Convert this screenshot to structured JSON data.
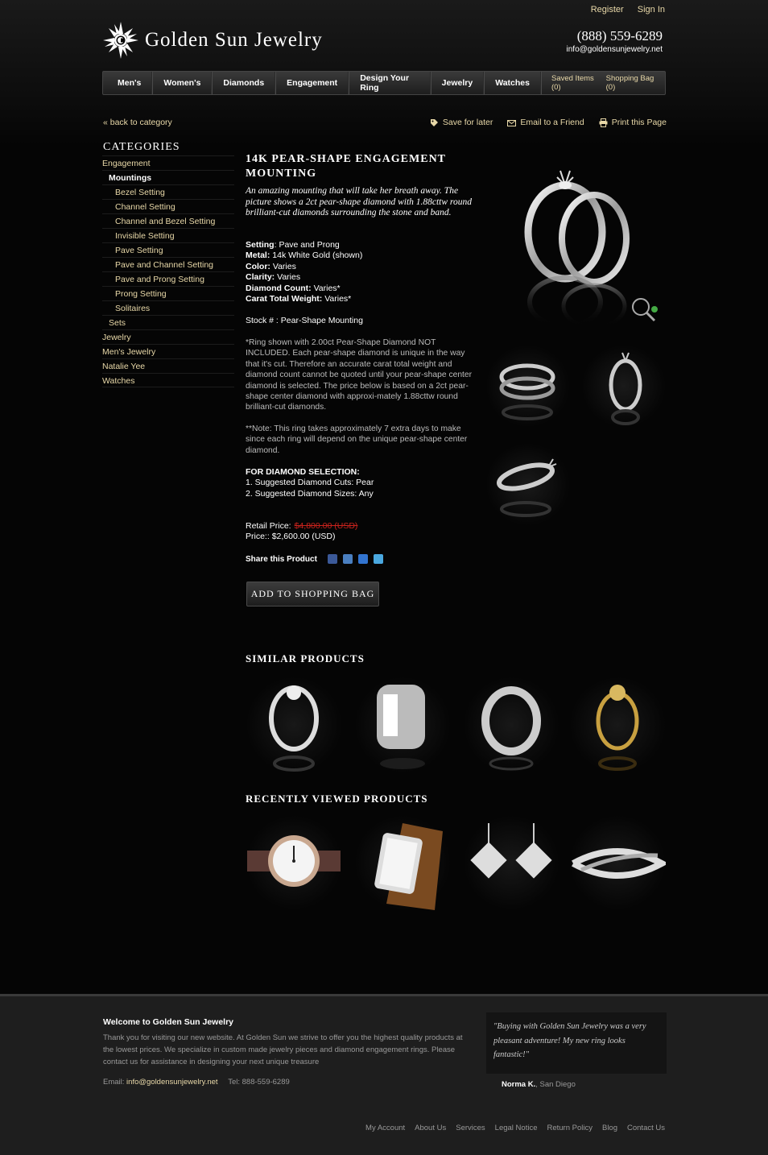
{
  "header": {
    "top_links": [
      "Register",
      "Sign In"
    ],
    "logo_text": "Golden Sun Jewelry",
    "phone": "(888) 559-6289",
    "email": "info@goldensunjewelry.net"
  },
  "nav": {
    "items": [
      "Men's",
      "Women's",
      "Diamonds",
      "Engagement",
      "Design Your Ring",
      "Jewelry",
      "Watches"
    ],
    "saved_items": "Saved Items (0)",
    "shopping_bag": "Shopping Bag (0)"
  },
  "actions": {
    "back": "« back to category",
    "save": "Save for later",
    "email": "Email to a Friend",
    "print": "Print this Page"
  },
  "sidebar": {
    "title": "CATEGORIES",
    "items": [
      {
        "label": "Engagement",
        "level": 0
      },
      {
        "label": "Mountings",
        "level": 1
      },
      {
        "label": "Bezel Setting",
        "level": 2
      },
      {
        "label": "Channel Setting",
        "level": 2
      },
      {
        "label": "Channel and Bezel Setting",
        "level": 2
      },
      {
        "label": "Invisible Setting",
        "level": 2
      },
      {
        "label": "Pave Setting",
        "level": 2
      },
      {
        "label": "Pave and Channel Setting",
        "level": 2
      },
      {
        "label": "Pave and Prong Setting",
        "level": 2
      },
      {
        "label": "Prong Setting",
        "level": 2
      },
      {
        "label": "Solitaires",
        "level": 2
      },
      {
        "label": "Sets",
        "level": 1
      },
      {
        "label": "Jewelry",
        "level": 0
      },
      {
        "label": "Men's Jewelry",
        "level": 0
      },
      {
        "label": "Natalie Yee",
        "level": 0
      },
      {
        "label": "Watches",
        "level": 0
      }
    ]
  },
  "product": {
    "title": "14K PEAR-SHAPE ENGAGEMENT MOUNTING",
    "intro": "An amazing mounting that will take her breath away. The picture shows a 2ct pear-shape diamond with 1.88cttw round brilliant-cut diamonds surrounding the stone and band.",
    "specs": [
      {
        "label": "Setting",
        "sep": ": ",
        "value": "Pave and Prong"
      },
      {
        "label": "Metal:",
        "sep": " ",
        "value": "14k White Gold (shown)"
      },
      {
        "label": "Color:",
        "sep": " ",
        "value": "Varies"
      },
      {
        "label": "Clarity:",
        "sep": " ",
        "value": "Varies"
      },
      {
        "label": "Diamond Count:",
        "sep": " ",
        "value": "Varies*"
      },
      {
        "label": "Carat Total Weight:",
        "sep": " ",
        "value": "Varies*"
      }
    ],
    "stock": "Stock # : Pear-Shape Mounting",
    "note1": "*Ring shown with 2.00ct Pear-Shape Diamond NOT INCLUDED.  Each pear-shape diamond is unique in the way that it's cut.  Therefore an accurate carat total weight and diamond count cannot be quoted until your pear-shape center diamond is selected.  The price below is based on a 2ct pear-shape center diamond with approxi-mately 1.88cttw round brilliant-cut diamonds.",
    "note2": "**Note: This ring takes approximately 7 extra days to make since each ring will depend on the unique pear-shape center diamond.",
    "diamond_selection_title": "FOR DIAMOND SELECTION:",
    "diamond_selection": [
      "1.  Suggested Diamond Cuts:  Pear",
      "2.  Suggested Diamond Sizes:  Any"
    ],
    "retail_label": "Retail Price:",
    "retail_price": "$4,800.00 (USD)",
    "price_label": "Price::",
    "price": "$2,600.00 (USD)",
    "share_label": "Share this Product",
    "add_button": "ADD TO SHOPPING BAG"
  },
  "similar_title": "SIMILAR PRODUCTS",
  "recent_title": "RECENTLY VIEWED PRODUCTS",
  "footer": {
    "welcome": "Welcome to Golden Sun Jewelry",
    "text": "Thank you for visiting our new website.  At Golden Sun we strive to offer you the highest quality products at the lowest prices. We specialize in custom made jewelry pieces and diamond engagement rings. Please contact us for assistance in designing your next unique treasure",
    "email_label": "Email:",
    "email": "info@goldensunjewelry.net",
    "tel": "Tel: 888-559-6289",
    "quote": "\"Buying with Golden Sun Jewelry was a very pleasant adventure! My new ring looks fantastic!\"",
    "quote_author": "Norma K.",
    "quote_location": ", San Diego",
    "links": [
      "My Account",
      "About Us",
      "Services",
      "Legal Notice",
      "Return Policy",
      "Blog",
      "Contact Us"
    ]
  },
  "colors": {
    "accent": "#e8d8a8",
    "strike": "#c8221c",
    "background": "#050505"
  }
}
